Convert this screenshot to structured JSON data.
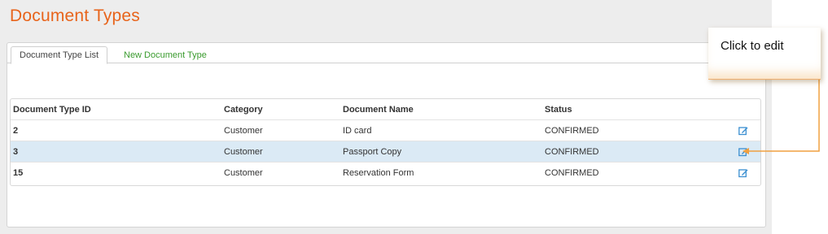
{
  "page": {
    "title": "Document Types"
  },
  "tabs": [
    {
      "label": "Document Type List",
      "active": true
    },
    {
      "label": "New Document Type",
      "active": false
    }
  ],
  "table": {
    "columns": [
      "Document Type ID",
      "Category",
      "Document Name",
      "Status"
    ],
    "rows": [
      {
        "id": "2",
        "category": "Customer",
        "name": "ID card",
        "status": "CONFIRMED"
      },
      {
        "id": "3",
        "category": "Customer",
        "name": "Passport Copy",
        "status": "CONFIRMED"
      },
      {
        "id": "15",
        "category": "Customer",
        "name": "Reservation Form",
        "status": "CONFIRMED"
      }
    ],
    "row_action_icon": "edit-icon"
  },
  "callout": {
    "text": "Click to edit"
  },
  "colors": {
    "title": "#e8641b",
    "new_tab": "#3a9b2e",
    "highlight_row": "#dbeaf5",
    "edit_icon": "#3b8fd1",
    "connector": "#f0a040"
  }
}
